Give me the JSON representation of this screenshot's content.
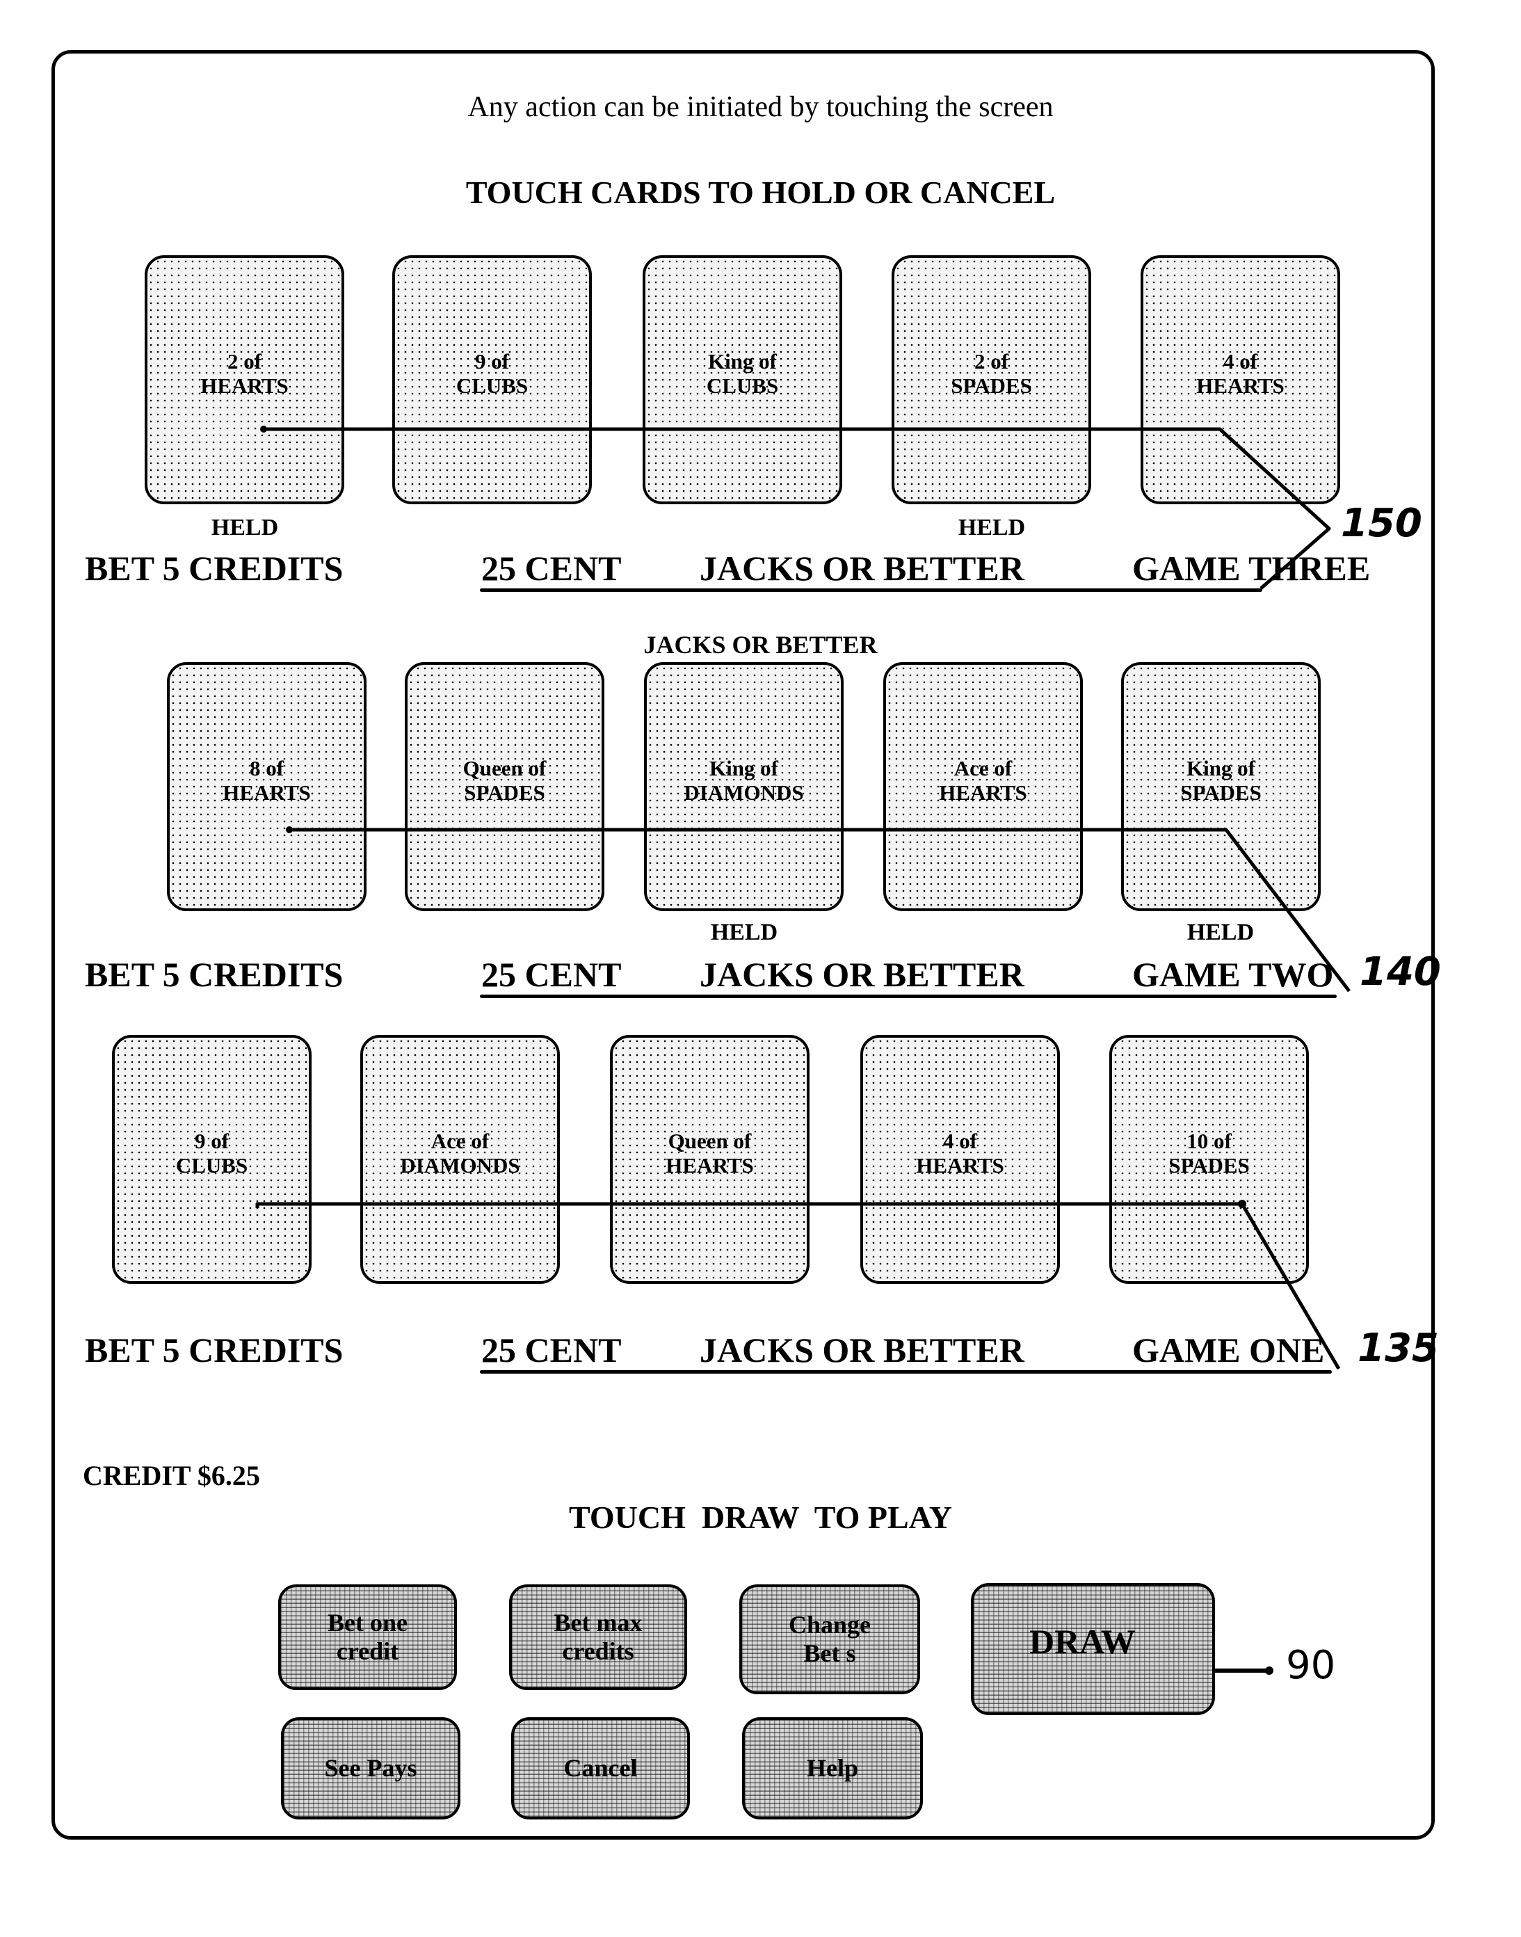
{
  "intro_text": "Any action can be initiated by touching the screen",
  "hold_instruction": "TOUCH CARDS TO HOLD OR CANCEL",
  "held_label": "HELD",
  "games": [
    {
      "id": "game-three",
      "header": "",
      "cards": [
        {
          "line1": "2 of",
          "line2": "HEARTS",
          "held": true
        },
        {
          "line1": "9 of",
          "line2": "CLUBS",
          "held": false
        },
        {
          "line1": "King of",
          "line2": "CLUBS",
          "held": false
        },
        {
          "line1": "2 of",
          "line2": "SPADES",
          "held": true
        },
        {
          "line1": "4 of",
          "line2": "HEARTS",
          "held": false
        }
      ],
      "bet": "BET 5 CREDITS",
      "denomination": "25 CENT",
      "game_type": "JACKS OR BETTER",
      "game_name": "GAME THREE",
      "reference_numeral": "150"
    },
    {
      "id": "game-two",
      "header": "JACKS OR BETTER",
      "cards": [
        {
          "line1": "8 of",
          "line2": "HEARTS",
          "held": false
        },
        {
          "line1": "Queen of",
          "line2": "SPADES",
          "held": false
        },
        {
          "line1": "King of",
          "line2": "DIAMONDS",
          "held": true
        },
        {
          "line1": "Ace of",
          "line2": "HEARTS",
          "held": false
        },
        {
          "line1": "King of",
          "line2": "SPADES",
          "held": true
        }
      ],
      "bet": "BET 5 CREDITS",
      "denomination": "25 CENT",
      "game_type": "JACKS OR BETTER",
      "game_name": "GAME TWO",
      "reference_numeral": "140"
    },
    {
      "id": "game-one",
      "header": "",
      "cards": [
        {
          "line1": "9 of",
          "line2": "CLUBS",
          "held": false
        },
        {
          "line1": "Ace of",
          "line2": "DIAMONDS",
          "held": false
        },
        {
          "line1": "Queen of",
          "line2": "HEARTS",
          "held": false
        },
        {
          "line1": "4 of",
          "line2": "HEARTS",
          "held": false
        },
        {
          "line1": "10 of",
          "line2": "SPADES",
          "held": false
        }
      ],
      "bet": "BET 5 CREDITS",
      "denomination": "25 CENT",
      "game_type": "JACKS OR BETTER",
      "game_name": "GAME ONE",
      "reference_numeral": "135"
    }
  ],
  "credit": "CREDIT $6.25",
  "draw_instruction": "TOUCH  DRAW  TO PLAY",
  "buttons": {
    "bet_one": {
      "line1": "Bet one",
      "line2": "credit"
    },
    "bet_max": {
      "line1": "Bet max",
      "line2": "credits"
    },
    "change_bets": {
      "line1": "Change",
      "line2": "Bet s"
    },
    "draw": {
      "line1": "DRAW"
    },
    "see_pays": {
      "line1": "See Pays"
    },
    "cancel": {
      "line1": "Cancel"
    },
    "help": {
      "line1": "Help"
    }
  },
  "draw_reference_numeral": "90"
}
